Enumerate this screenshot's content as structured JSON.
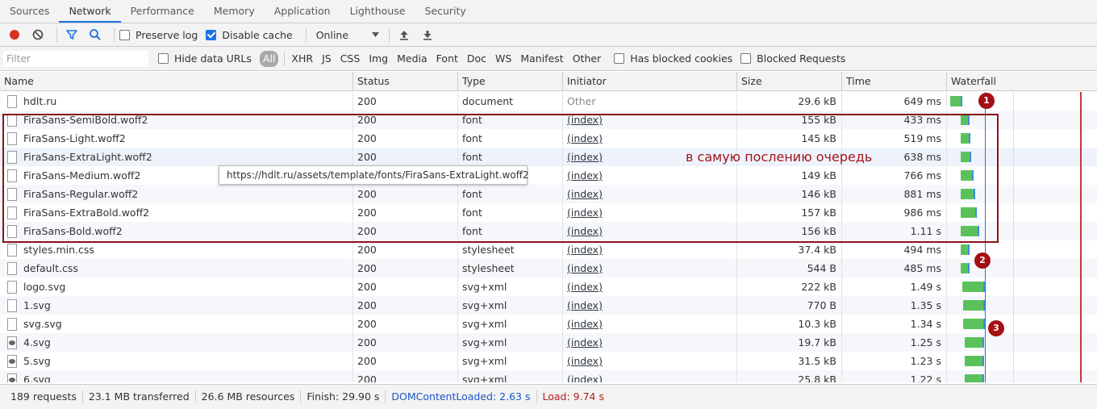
{
  "tabs": [
    {
      "label": "Sources",
      "active": false
    },
    {
      "label": "Network",
      "active": true
    },
    {
      "label": "Performance",
      "active": false
    },
    {
      "label": "Memory",
      "active": false
    },
    {
      "label": "Application",
      "active": false
    },
    {
      "label": "Lighthouse",
      "active": false
    },
    {
      "label": "Security",
      "active": false
    }
  ],
  "toolbar": {
    "preserve_log": {
      "label": "Preserve log",
      "checked": false
    },
    "disable_cache": {
      "label": "Disable cache",
      "checked": true
    },
    "throttling": "Online",
    "record_color": "#d93025",
    "filter_icon_color": "#1a73e8"
  },
  "filterbar": {
    "placeholder": "Filter",
    "hide_data_urls": "Hide data URLs",
    "types": [
      "All",
      "XHR",
      "JS",
      "CSS",
      "Img",
      "Media",
      "Font",
      "Doc",
      "WS",
      "Manifest",
      "Other"
    ],
    "active_type": "All",
    "has_blocked_cookies": "Has blocked cookies",
    "blocked_requests": "Blocked Requests"
  },
  "columns": {
    "name": "Name",
    "status": "Status",
    "type": "Type",
    "initiator": "Initiator",
    "size": "Size",
    "time": "Time",
    "waterfall": "Waterfall"
  },
  "rows": [
    {
      "name": "hdlt.ru",
      "status": "200",
      "type": "document",
      "initiator": "Other",
      "size": "29.6 kB",
      "time": "649 ms",
      "wf_start": 0.0,
      "wf_len": 0.9
    },
    {
      "name": "FiraSans-SemiBold.woff2",
      "status": "200",
      "type": "font",
      "initiator": "(index)",
      "size": "155 kB",
      "time": "433 ms",
      "wf_start": 0.95,
      "wf_len": 0.6
    },
    {
      "name": "FiraSans-Light.woff2",
      "status": "200",
      "type": "font",
      "initiator": "(index)",
      "size": "145 kB",
      "time": "519 ms",
      "wf_start": 0.95,
      "wf_len": 0.7
    },
    {
      "name": "FiraSans-ExtraLight.woff2",
      "status": "200",
      "type": "font",
      "initiator": "(index)",
      "size": "",
      "time": "638 ms",
      "wf_start": 0.95,
      "wf_len": 0.8
    },
    {
      "name": "FiraSans-Medium.woff2",
      "status": "",
      "type": "",
      "initiator": "(index)",
      "size": "149 kB",
      "time": "766 ms",
      "wf_start": 0.95,
      "wf_len": 1.0
    },
    {
      "name": "FiraSans-Regular.woff2",
      "status": "200",
      "type": "font",
      "initiator": "(index)",
      "size": "146 kB",
      "time": "881 ms",
      "wf_start": 0.95,
      "wf_len": 1.15
    },
    {
      "name": "FiraSans-ExtraBold.woff2",
      "status": "200",
      "type": "font",
      "initiator": "(index)",
      "size": "157 kB",
      "time": "986 ms",
      "wf_start": 0.95,
      "wf_len": 1.3
    },
    {
      "name": "FiraSans-Bold.woff2",
      "status": "200",
      "type": "font",
      "initiator": "(index)",
      "size": "156 kB",
      "time": "1.11 s",
      "wf_start": 0.95,
      "wf_len": 1.45
    },
    {
      "name": "styles.min.css",
      "status": "200",
      "type": "stylesheet",
      "initiator": "(index)",
      "size": "37.4 kB",
      "time": "494 ms",
      "wf_start": 0.95,
      "wf_len": 0.65
    },
    {
      "name": "default.css",
      "status": "200",
      "type": "stylesheet",
      "initiator": "(index)",
      "size": "544 B",
      "time": "485 ms",
      "wf_start": 0.95,
      "wf_len": 0.65
    },
    {
      "name": "logo.svg",
      "status": "200",
      "type": "svg+xml",
      "initiator": "(index)",
      "size": "222 kB",
      "time": "1.49 s",
      "wf_start": 1.1,
      "wf_len": 1.8
    },
    {
      "name": "1.svg",
      "status": "200",
      "type": "svg+xml",
      "initiator": "(index)",
      "size": "770 B",
      "time": "1.35 s",
      "wf_start": 1.15,
      "wf_len": 1.75
    },
    {
      "name": "svg.svg",
      "status": "200",
      "type": "svg+xml",
      "initiator": "(index)",
      "size": "10.3 kB",
      "time": "1.34 s",
      "wf_start": 1.15,
      "wf_len": 1.75
    },
    {
      "name": "4.svg",
      "status": "200",
      "type": "svg+xml",
      "initiator": "(index)",
      "size": "19.7 kB",
      "time": "1.25 s",
      "wf_start": 1.3,
      "wf_len": 1.55
    },
    {
      "name": "5.svg",
      "status": "200",
      "type": "svg+xml",
      "initiator": "(index)",
      "size": "31.5 kB",
      "time": "1.23 s",
      "wf_start": 1.3,
      "wf_len": 1.55
    },
    {
      "name": "6.svg",
      "status": "200",
      "type": "svg+xml",
      "initiator": "(index)",
      "size": "25.8 kB",
      "time": "1.22 s",
      "wf_start": 1.3,
      "wf_len": 1.55
    }
  ],
  "tooltip": "https://hdlt.ru/assets/template/fonts/FiraSans-ExtraLight.woff2",
  "annotation": {
    "text": "в самую послению очередь",
    "markers": [
      "1",
      "2",
      "3"
    ],
    "color": "#a60e14"
  },
  "status": {
    "requests": "189 requests",
    "transferred": "23.1 MB transferred",
    "resources": "26.6 MB resources",
    "finish": "Finish: 29.90 s",
    "dom": "DOMContentLoaded: 2.63 s",
    "load": "Load: 9.74 s"
  }
}
